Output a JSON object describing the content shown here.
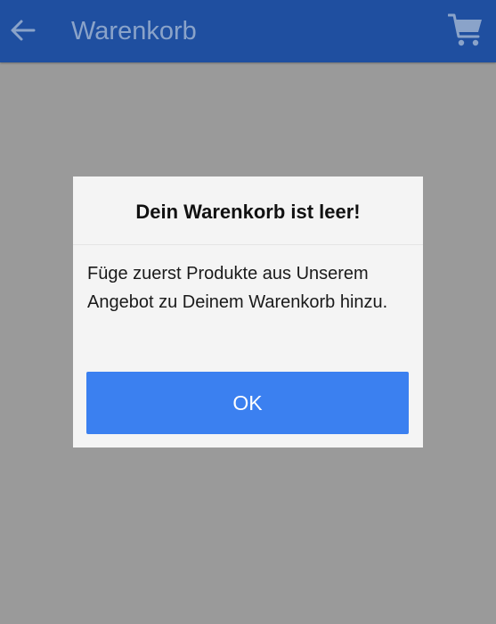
{
  "header": {
    "title": "Warenkorb",
    "back_icon": "arrow-left-icon",
    "cart_icon": "shopping-cart-icon"
  },
  "dialog": {
    "title": "Dein Warenkorb ist leer!",
    "message": "Füge zuerst Produkte aus Unserem Angebot zu Deinem Warenkorb hinzu.",
    "ok_label": "OK"
  },
  "colors": {
    "app_bar": "#1f4fa0",
    "overlay": "#9a9a9a",
    "dialog_background": "#f4f4f4",
    "primary_button": "#3b80f0",
    "header_icon": "#8aa3c9"
  }
}
